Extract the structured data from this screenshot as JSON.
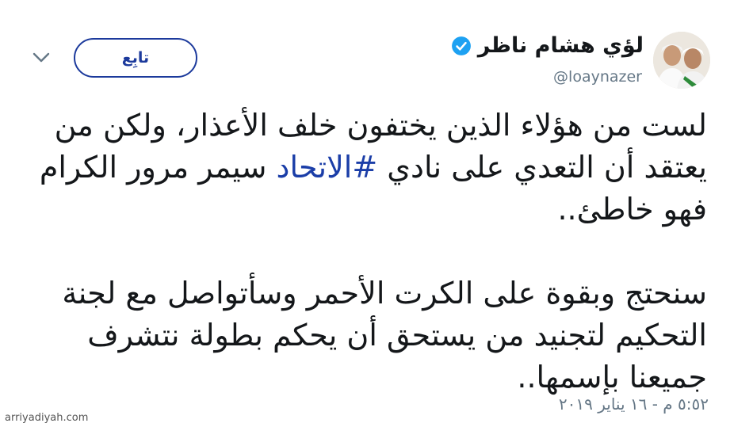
{
  "header": {
    "display_name": "لؤي هشام ناظر",
    "handle": "@loaynazer",
    "verified_icon": "verified-badge-icon",
    "verified_color": "#1da1f2",
    "follow_label": "تابِع",
    "follow_color": "#1c3a9c",
    "menu_icon": "chevron-down-icon"
  },
  "tweet": {
    "para1_text_before": "لست من هؤلاء الذين يختفون خلف الأعذار، ولكن من يعتقد أن التعدي على نادي ",
    "hashtag": "#الاتحاد",
    "hashtag_color": "#1b3ea8",
    "para1_text_after": " سيمر مرور الكرام فهو خاطئ..",
    "para2_text": "سنحتج وبقوة على الكرت الأحمر وسأتواصل مع لجنة التحكيم لتجنيد من يستحق أن يحكم بطولة نتشرف جميعنا بإسمها..",
    "timestamp": "٥:٥٢ م - ١٦ يناير ٢٠١٩"
  },
  "watermark": "arriyadiyah.com"
}
